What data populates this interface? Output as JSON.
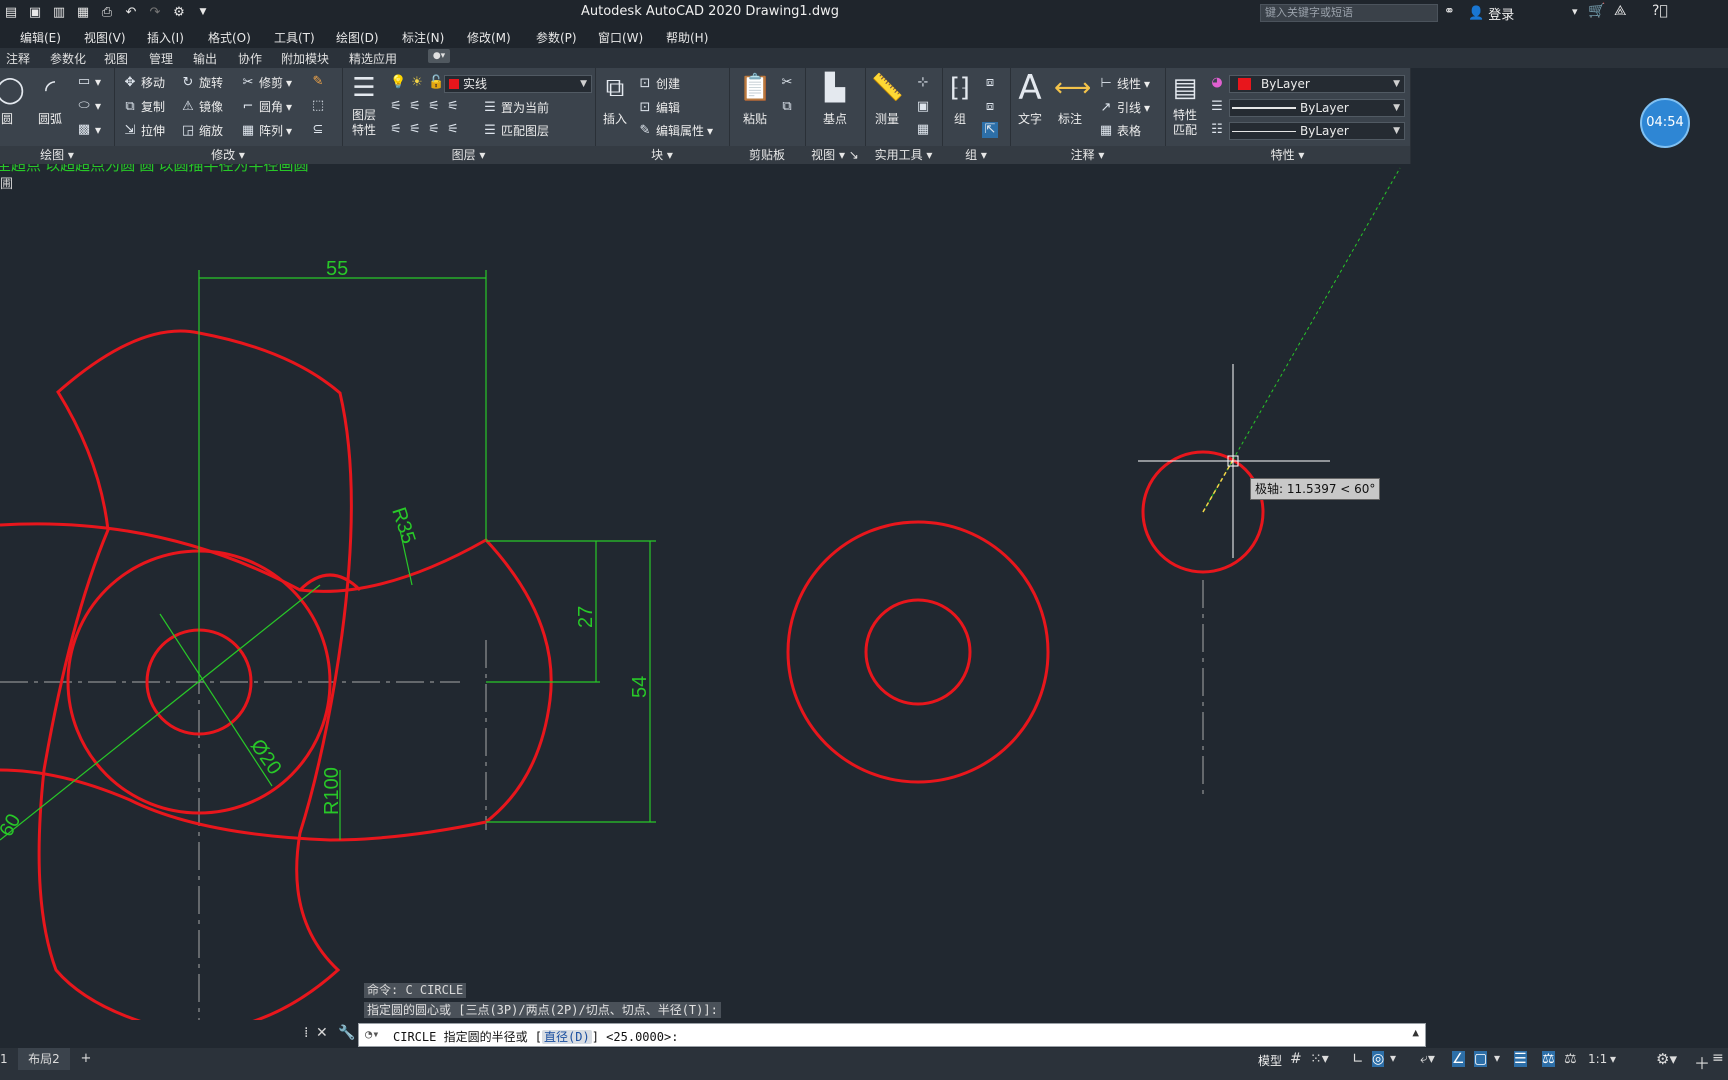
{
  "app": {
    "title": "Autodesk AutoCAD 2020    Drawing1.dwg",
    "search_placeholder": "键入关键字或短语",
    "login": "登录"
  },
  "menu": [
    "编辑(E)",
    "视图(V)",
    "插入(I)",
    "格式(O)",
    "工具(T)",
    "绘图(D)",
    "标注(N)",
    "修改(M)",
    "参数(P)",
    "窗口(W)",
    "帮助(H)"
  ],
  "tabs": [
    "注释",
    "参数化",
    "视图",
    "管理",
    "输出",
    "协作",
    "附加模块",
    "精选应用"
  ],
  "ribbon": {
    "draw": {
      "circle": "圆",
      "arc": "圆弧",
      "label": "绘图"
    },
    "modify": {
      "move": "移动",
      "rotate": "旋转",
      "trim": "修剪",
      "copy": "复制",
      "mirror": "镜像",
      "fillet": "圆角",
      "stretch": "拉伸",
      "scale": "缩放",
      "array": "阵列",
      "label": "修改"
    },
    "layers": {
      "props": "图层\n特性",
      "current_layer": "实线",
      "set_current": "置为当前",
      "match": "匹配图层",
      "label": "图层"
    },
    "block": {
      "insert": "插入",
      "create": "创建",
      "edit": "编辑",
      "edit_attr": "编辑属性",
      "label": "块"
    },
    "clipboard": {
      "paste": "粘贴",
      "label": "剪贴板"
    },
    "view": {
      "basepoint": "基点",
      "label": "视图"
    },
    "utilities": {
      "measure": "测量",
      "label": "实用工具"
    },
    "groups": {
      "group": "组",
      "label": "组"
    },
    "annotation": {
      "text": "文字",
      "dim": "标注",
      "linear": "线性",
      "leader": "引线",
      "table": "表格",
      "label": "注释"
    },
    "properties": {
      "match": "特性\n匹配",
      "color": "ByLayer",
      "linetype": "ByLayer",
      "lineweight": "ByLayer",
      "label": "特性"
    }
  },
  "clock": "04:54",
  "drawing": {
    "dims": [
      "55",
      "R35",
      "27",
      "54",
      "Ø20",
      "R100",
      "60"
    ],
    "tooltip": "极轴: 11.5397 < 60°",
    "accent": "#e8161c",
    "dim_color": "#28c828"
  },
  "command": {
    "history1": "命令: C CIRCLE",
    "history2": "指定圆的圆心或 [三点(3P)/两点(2P)/切点、切点、半径(T)]:",
    "prompt_pre": "CIRCLE 指定圆的半径或 [",
    "prompt_opt": "直径(D)",
    "prompt_post": "] <25.0000>:"
  },
  "layout_tabs": [
    "1",
    "布局2",
    "+"
  ],
  "status": {
    "model": "模型",
    "scale": "1:1"
  }
}
